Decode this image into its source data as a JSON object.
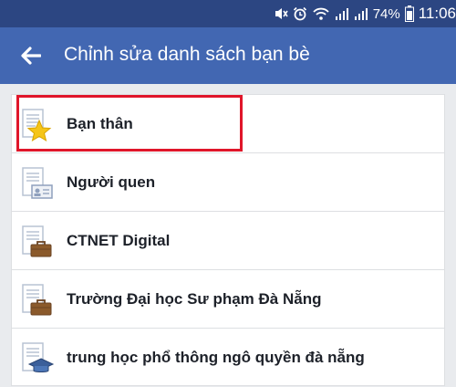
{
  "status_bar": {
    "battery_percent": "74%",
    "time": "11:06"
  },
  "app_bar": {
    "title": "Chỉnh sửa danh sách bạn bè",
    "back_icon": "arrow-left-icon"
  },
  "friend_lists": [
    {
      "label": "Bạn thân",
      "icon": "star-list-icon",
      "highlighted": true
    },
    {
      "label": "Người quen",
      "icon": "id-card-list-icon",
      "highlighted": false
    },
    {
      "label": "CTNET Digital",
      "icon": "briefcase-list-icon",
      "highlighted": false
    },
    {
      "label": "Trường Đại học Sư phạm Đà Nẵng",
      "icon": "briefcase-list-icon",
      "highlighted": false
    },
    {
      "label": "trung học phổ thông ngô quyền đà nẵng",
      "icon": "graduation-cap-list-icon",
      "highlighted": false
    }
  ],
  "colors": {
    "status_bar": "#2c4682",
    "app_bar": "#4267b2",
    "highlight": "#e0162a",
    "background": "#e9ebee"
  }
}
